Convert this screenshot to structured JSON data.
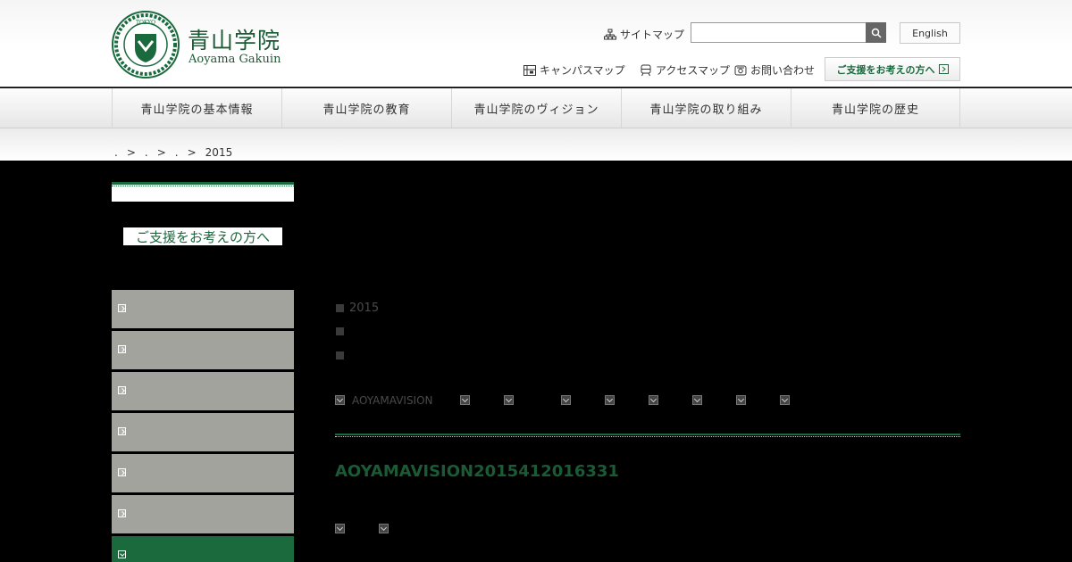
{
  "header": {
    "logo_ja": "青山学院",
    "logo_en": "Aoyama Gakuin",
    "logo_ring_top": "TOKYO",
    "logo_ring_left": "AOYAMA",
    "logo_ring_right": "GAKUIN",
    "sitemap_label": "サイトマップ",
    "search_value": "",
    "english_label": "English",
    "campus_map": "キャンパスマップ",
    "access_map": "アクセスマップ",
    "contact": "お問い合わせ",
    "support_label": "ご支援をお考えの方へ"
  },
  "gnav": [
    {
      "label": "青山学院の基本情報"
    },
    {
      "label": "青山学院の教育"
    },
    {
      "label": "青山学院のヴィジョン"
    },
    {
      "label": "青山学院の取り組み"
    },
    {
      "label": "青山学院の歴史"
    }
  ],
  "breadcrumb": {
    "items": [
      ".",
      ">",
      ".",
      ">",
      ".",
      ">"
    ],
    "current": "2015"
  },
  "sidebar": {
    "banner": "ご支援をお考えの方へ",
    "items": [
      {
        "label": "",
        "active": false
      },
      {
        "label": "",
        "active": false
      },
      {
        "label": "",
        "active": false
      },
      {
        "label": "",
        "active": false
      },
      {
        "label": "",
        "active": false
      },
      {
        "label": "",
        "active": false
      },
      {
        "label": "",
        "active": true
      }
    ]
  },
  "main": {
    "list": [
      "2015",
      "",
      ""
    ],
    "tab_first": "AOYAMAVISION",
    "title": "AOYAMAVISION2015412016331"
  },
  "colors": {
    "brand_green": "#1a6a3e",
    "sidebar_gray": "#a3a39e"
  }
}
